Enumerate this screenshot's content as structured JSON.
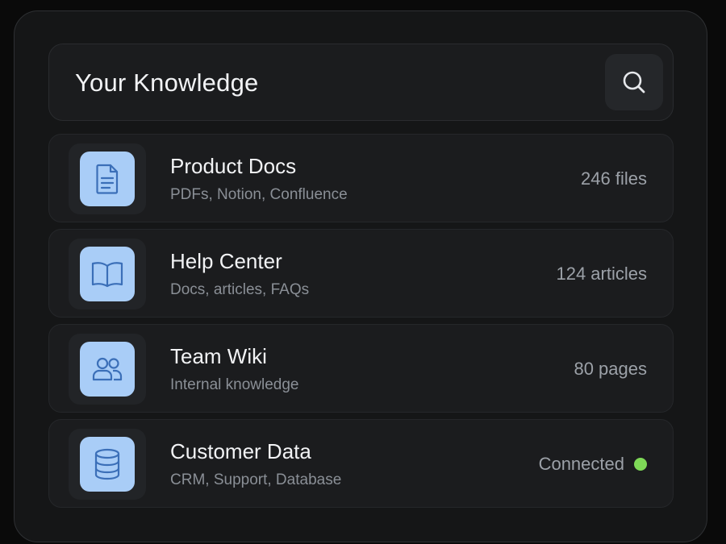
{
  "header": {
    "title": "Your Knowledge",
    "search_icon": "search-icon"
  },
  "sources": [
    {
      "title": "Product Docs",
      "subtitle": "PDFs, Notion, Confluence",
      "meta": "246 files",
      "icon": "document-icon"
    },
    {
      "title": "Help Center",
      "subtitle": "Docs, articles, FAQs",
      "meta": "124 articles",
      "icon": "book-icon"
    },
    {
      "title": "Team Wiki",
      "subtitle": "Internal knowledge",
      "meta": "80 pages",
      "icon": "users-icon"
    },
    {
      "title": "Customer Data",
      "subtitle": "CRM, Support, Database",
      "meta": "Connected",
      "icon": "database-icon",
      "status_color": "#7ed957"
    }
  ],
  "colors": {
    "accent": "#a9cdf7",
    "icon_stroke": "#3b6fb8",
    "connected": "#7ed957"
  }
}
